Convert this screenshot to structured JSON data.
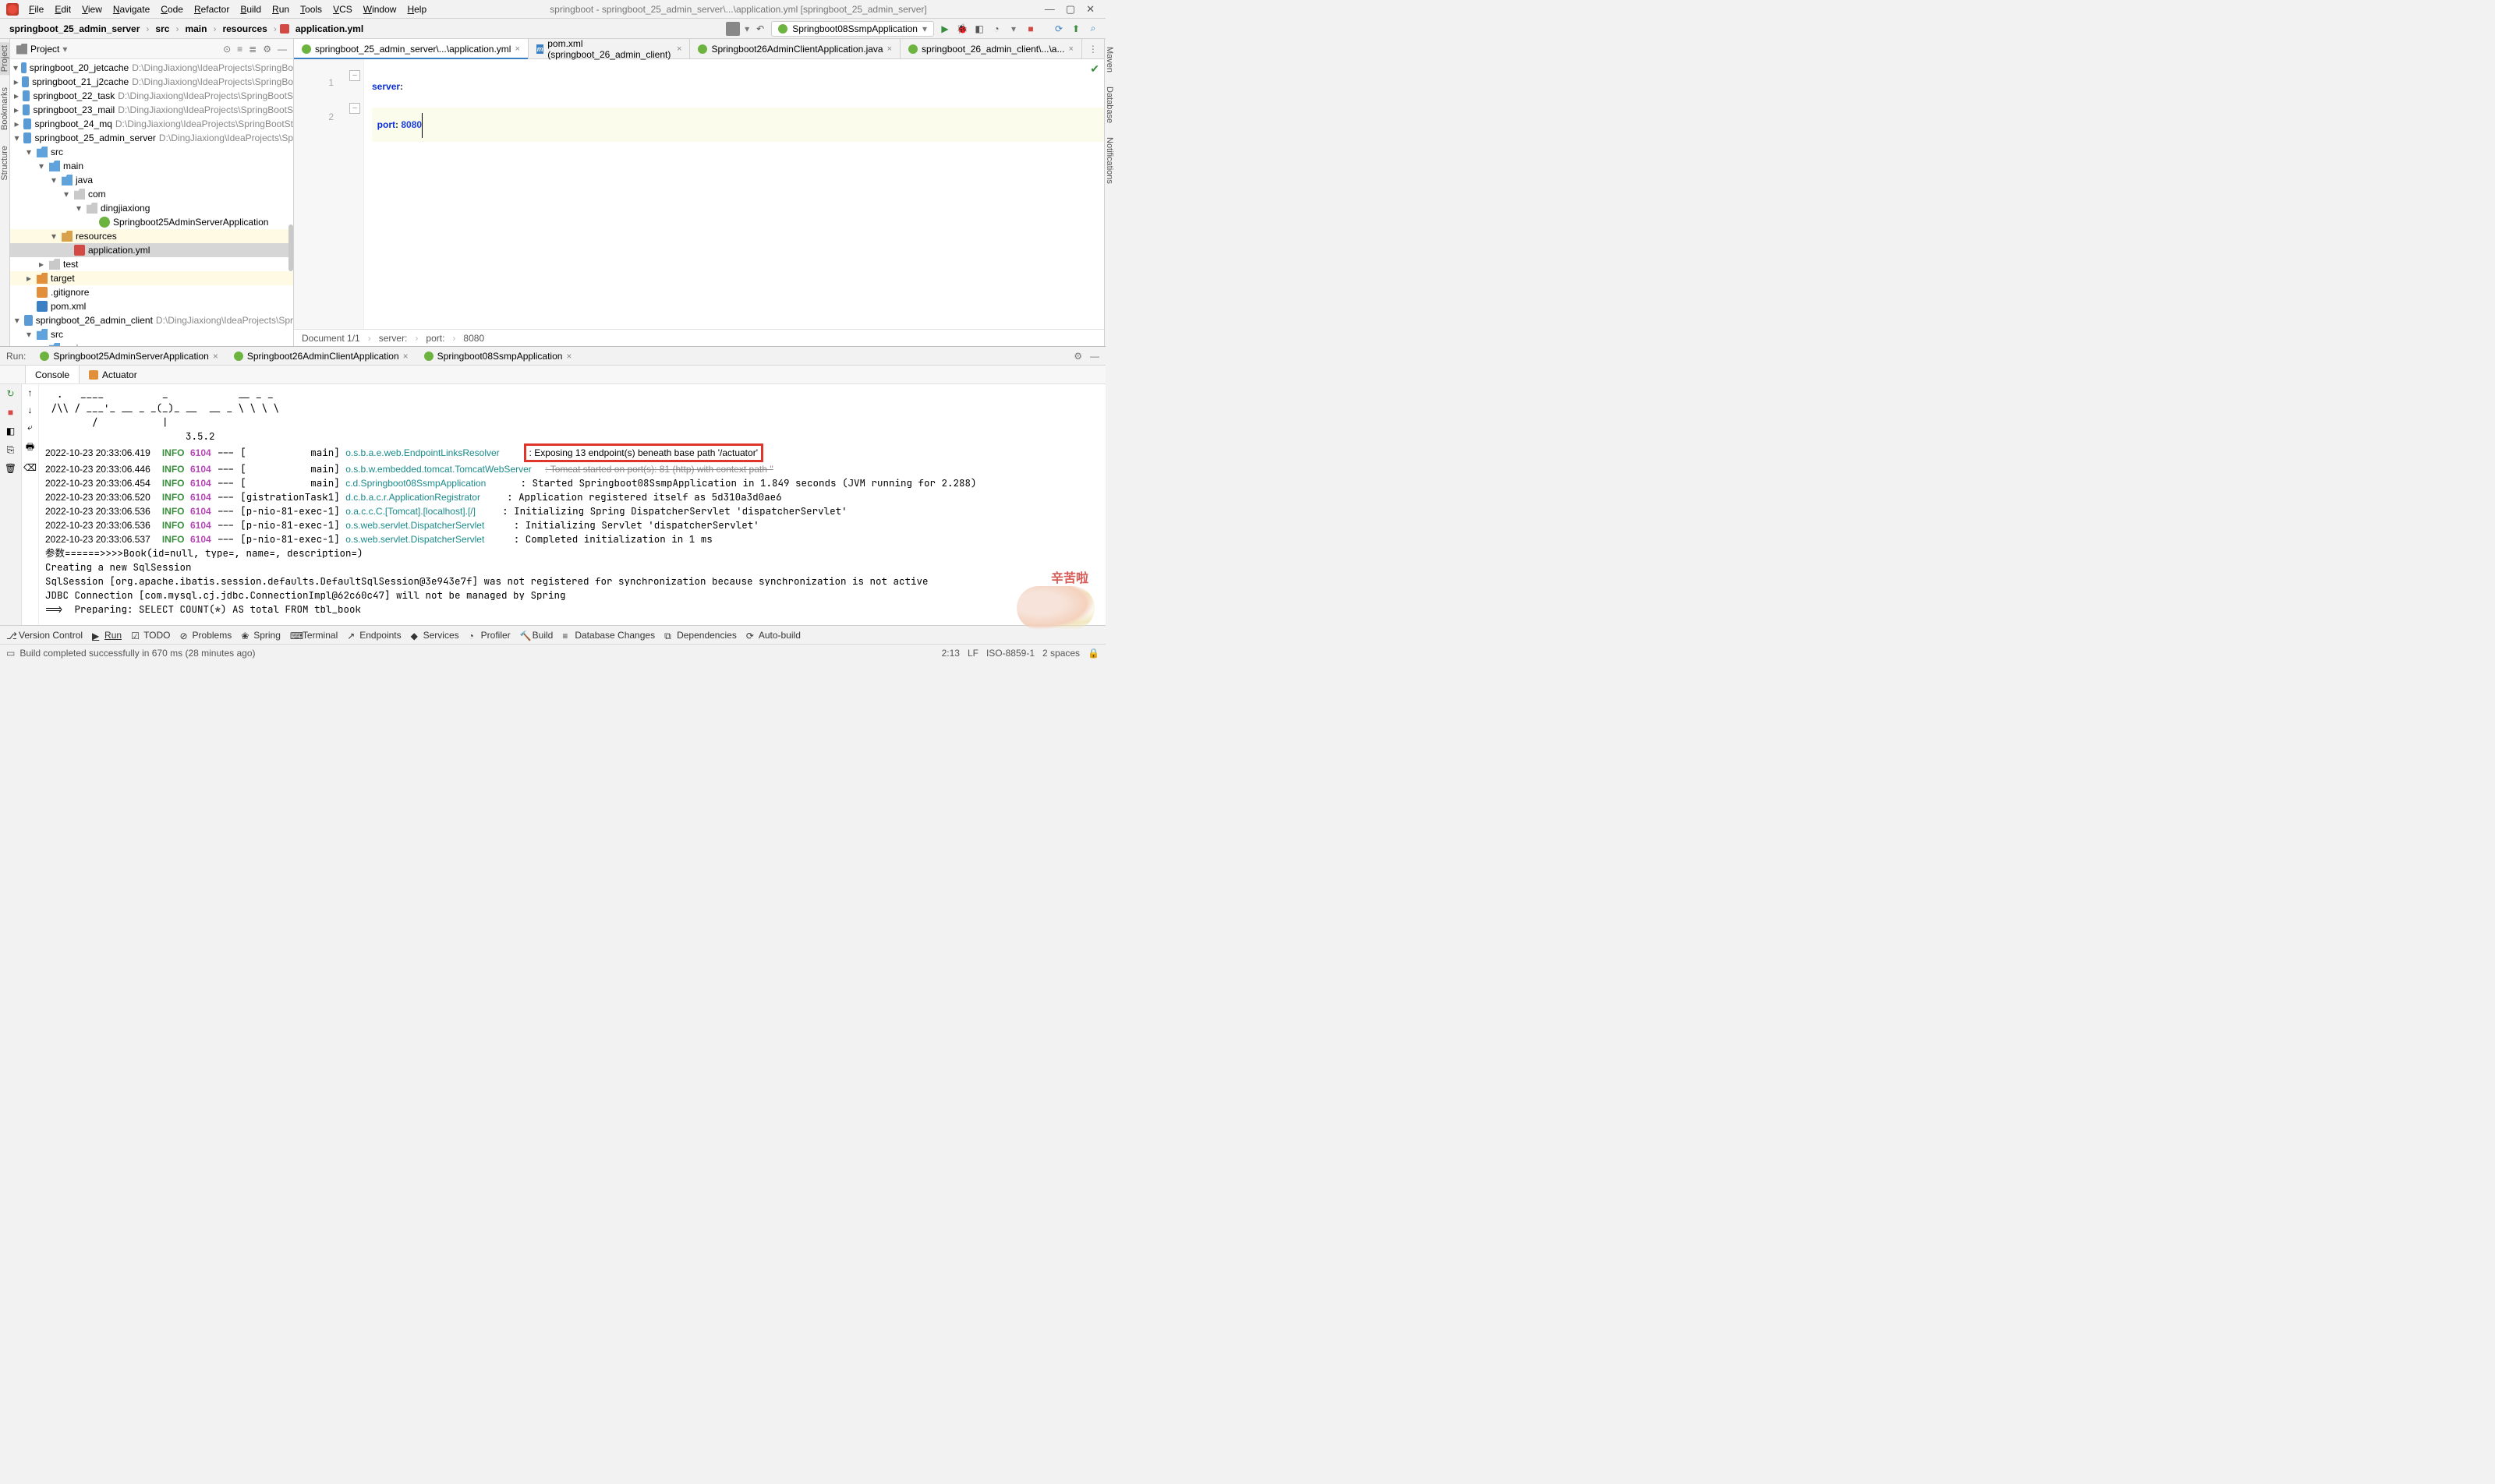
{
  "menu": {
    "items": [
      "File",
      "Edit",
      "View",
      "Navigate",
      "Code",
      "Refactor",
      "Build",
      "Run",
      "Tools",
      "VCS",
      "Window",
      "Help"
    ],
    "title": "springboot - springboot_25_admin_server\\...\\application.yml [springboot_25_admin_server]"
  },
  "breadcrumb": [
    "springboot_25_admin_server",
    "src",
    "main",
    "resources",
    "application.yml"
  ],
  "run_config": "Springboot08SsmpApplication",
  "project_header": "Project",
  "tree": [
    {
      "d": 0,
      "a": "down",
      "ic": "module",
      "name": "springboot_20_jetcache",
      "path": "D:\\DingJiaxiong\\IdeaProjects\\SpringBo"
    },
    {
      "d": 0,
      "a": "right",
      "ic": "module",
      "name": "springboot_21_j2cache",
      "path": "D:\\DingJiaxiong\\IdeaProjects\\SpringBo"
    },
    {
      "d": 0,
      "a": "right",
      "ic": "module",
      "name": "springboot_22_task",
      "path": "D:\\DingJiaxiong\\IdeaProjects\\SpringBootS"
    },
    {
      "d": 0,
      "a": "right",
      "ic": "module",
      "name": "springboot_23_mail",
      "path": "D:\\DingJiaxiong\\IdeaProjects\\SpringBootS"
    },
    {
      "d": 0,
      "a": "right",
      "ic": "module",
      "name": "springboot_24_mq",
      "path": "D:\\DingJiaxiong\\IdeaProjects\\SpringBootSt"
    },
    {
      "d": 0,
      "a": "down",
      "ic": "module",
      "name": "springboot_25_admin_server",
      "path": "D:\\DingJiaxiong\\IdeaProjects\\Sp"
    },
    {
      "d": 1,
      "a": "down",
      "ic": "folder-src",
      "name": "src"
    },
    {
      "d": 2,
      "a": "down",
      "ic": "folder-src",
      "name": "main"
    },
    {
      "d": 3,
      "a": "down",
      "ic": "folder-src",
      "name": "java"
    },
    {
      "d": 4,
      "a": "down",
      "ic": "folder",
      "name": "com"
    },
    {
      "d": 5,
      "a": "down",
      "ic": "folder",
      "name": "dingjiaxiong"
    },
    {
      "d": 6,
      "a": "none",
      "ic": "spring",
      "name": "Springboot25AdminServerApplication"
    },
    {
      "d": 3,
      "a": "down",
      "ic": "folder-res",
      "name": "resources",
      "hl": true
    },
    {
      "d": 4,
      "a": "none",
      "ic": "yaml",
      "name": "application.yml",
      "sel": true
    },
    {
      "d": 2,
      "a": "right",
      "ic": "folder",
      "name": "test"
    },
    {
      "d": 1,
      "a": "right",
      "ic": "folder-target",
      "name": "target",
      "hl": true
    },
    {
      "d": 1,
      "a": "none",
      "ic": "git",
      "name": ".gitignore"
    },
    {
      "d": 1,
      "a": "none",
      "ic": "maven",
      "name": "pom.xml"
    },
    {
      "d": 0,
      "a": "down",
      "ic": "module",
      "name": "springboot_26_admin_client",
      "path": "D:\\DingJiaxiong\\IdeaProjects\\Spr"
    },
    {
      "d": 1,
      "a": "down",
      "ic": "folder-src",
      "name": "src"
    },
    {
      "d": 2,
      "a": "down",
      "ic": "folder-src",
      "name": "main"
    }
  ],
  "editor_tabs": [
    {
      "label": "springboot_25_admin_server\\...\\application.yml",
      "ic": "spring",
      "active": true
    },
    {
      "label": "pom.xml (springboot_26_admin_client)",
      "ic": "maven"
    },
    {
      "label": "Springboot26AdminClientApplication.java",
      "ic": "spring"
    },
    {
      "label": "springboot_26_admin_client\\...\\a..."
    }
  ],
  "code": {
    "l1_key": "server",
    "l2_key": "port",
    "l2_val": "8080"
  },
  "editor_status": {
    "doc": "Document 1/1",
    "p1": "server:",
    "p2": "port:",
    "p3": "8080"
  },
  "run": {
    "label": "Run:",
    "tabs": [
      "Springboot25AdminServerApplication",
      "Springboot26AdminClientApplication",
      "Springboot08SsmpApplication"
    ],
    "active_tab": 2,
    "subtabs": [
      "Console",
      "Actuator"
    ],
    "ascii1": "  .   ____          _            __ _ _",
    "ascii2": " /\\\\ / ___'_ __ _ _(_)_ __  __ _ \\ \\ \\ \\",
    "ascii3": "        /           |",
    "version": "                        3.5.2",
    "lines": [
      {
        "ts": "2022-10-23 20:33:06.419",
        "lvl": "INFO",
        "pid": "6104",
        "thr": "--- [           main]",
        "cls": "o.s.b.a.e.web.EndpointLinksResolver       ",
        "msg": ": Exposing 13 endpoint(s) beneath base path '/actuator'",
        "box": true
      },
      {
        "ts": "2022-10-23 20:33:06.446",
        "lvl": "INFO",
        "pid": "6104",
        "thr": "--- [           main]",
        "cls": "o.s.b.w.embedded.tomcat.TomcatWebServer   ",
        "msg": ": Tomcat started on port(s): 81 (http) with context path ''",
        "strike": true
      },
      {
        "ts": "2022-10-23 20:33:06.454",
        "lvl": "INFO",
        "pid": "6104",
        "thr": "--- [           main]",
        "cls": "c.d.Springboot08SsmpApplication           ",
        "msg": ": Started Springboot08SsmpApplication in 1.849 seconds (JVM running for 2.288)"
      },
      {
        "ts": "2022-10-23 20:33:06.520",
        "lvl": "INFO",
        "pid": "6104",
        "thr": "--- [gistrationTask1]",
        "cls": "d.c.b.a.c.r.ApplicationRegistrator        ",
        "msg": ": Application registered itself as 5d310a3d0ae6"
      },
      {
        "ts": "2022-10-23 20:33:06.536",
        "lvl": "INFO",
        "pid": "6104",
        "thr": "--- [p-nio-81-exec-1]",
        "cls": "o.a.c.c.C.[Tomcat].[localhost].[/]        ",
        "msg": ": Initializing Spring DispatcherServlet 'dispatcherServlet'"
      },
      {
        "ts": "2022-10-23 20:33:06.536",
        "lvl": "INFO",
        "pid": "6104",
        "thr": "--- [p-nio-81-exec-1]",
        "cls": "o.s.web.servlet.DispatcherServlet         ",
        "msg": ": Initializing Servlet 'dispatcherServlet'"
      },
      {
        "ts": "2022-10-23 20:33:06.537",
        "lvl": "INFO",
        "pid": "6104",
        "thr": "--- [p-nio-81-exec-1]",
        "cls": "o.s.web.servlet.DispatcherServlet         ",
        "msg": ": Completed initialization in 1 ms"
      }
    ],
    "tail": [
      "参数======>>>>Book(id=null, type=, name=, description=)",
      "Creating a new SqlSession",
      "SqlSession [org.apache.ibatis.session.defaults.DefaultSqlSession@3e943e7f] was not registered for synchronization because synchronization is not active",
      "JDBC Connection [com.mysql.cj.jdbc.ConnectionImpl@62c60c47] will not be managed by Spring",
      "==>  Preparing: SELECT COUNT(*) AS total FROM tbl_book"
    ]
  },
  "bottombar": [
    "Version Control",
    "Run",
    "TODO",
    "Problems",
    "Spring",
    "Terminal",
    "Endpoints",
    "Services",
    "Profiler",
    "Build",
    "Database Changes",
    "Dependencies",
    "Auto-build"
  ],
  "status": {
    "msg": "Build completed successfully in 670 ms (28 minutes ago)",
    "pos": "2:13",
    "lf": "LF",
    "enc": "ISO-8859-1",
    "indent": "2 spaces"
  },
  "sticker_text": "辛苦啦",
  "right_tools": [
    "Maven",
    "Database",
    "Notifications"
  ]
}
